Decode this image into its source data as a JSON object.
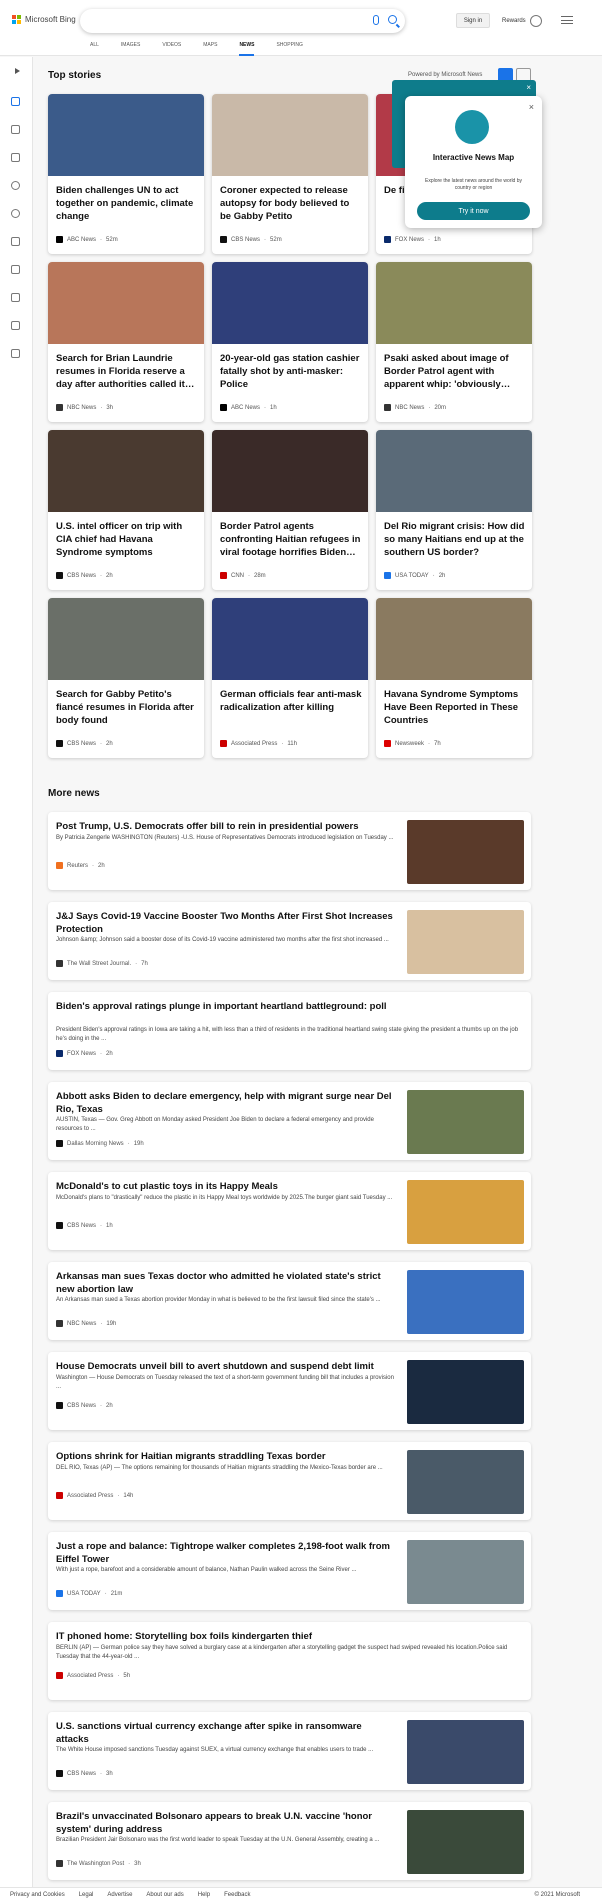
{
  "brand": {
    "name": "Microsoft Bing"
  },
  "header": {
    "sign_in": "Sign in",
    "rewards": "Rewards"
  },
  "nav_tabs": [
    "ALL",
    "IMAGES",
    "VIDEOS",
    "MAPS",
    "NEWS",
    "SHOPPING"
  ],
  "active_tab": "NEWS",
  "top_stories": {
    "heading": "Top stories",
    "powered_by": "Powered by Microsoft News",
    "cards": [
      {
        "title": "Biden challenges UN to act together on pandemic, climate change",
        "source": "ABC News",
        "age": "52m",
        "img": "#3b5b8a",
        "src_color": "#000"
      },
      {
        "title": "Coroner expected to release autopsy for body believed to be Gabby Petito",
        "source": "CBS News",
        "age": "52m",
        "img": "#c9b9a8",
        "src_color": "#111"
      },
      {
        "title": "De fi re",
        "source": "FOX News",
        "age": "1h",
        "img": "#b23a48",
        "src_color": "#0a2a6b"
      },
      {
        "title": "Search for Brian Laundrie resumes in Florida reserve a day after authorities called it…",
        "source": "NBC News",
        "age": "3h",
        "img": "#b8765a",
        "src_color": "#333"
      },
      {
        "title": "20-year-old gas station cashier fatally shot by anti-masker: Police",
        "source": "ABC News",
        "age": "1h",
        "img": "#2f3f7a",
        "src_color": "#000"
      },
      {
        "title": "Psaki asked about image of Border Patrol agent with apparent whip: 'obviously…",
        "source": "NBC News",
        "age": "20m",
        "img": "#8a8a5a",
        "src_color": "#333"
      },
      {
        "title": "U.S. intel officer on trip with CIA chief had Havana Syndrome symptoms",
        "source": "CBS News",
        "age": "2h",
        "img": "#4a3a30",
        "src_color": "#111"
      },
      {
        "title": "Border Patrol agents confronting Haitian refugees in viral footage horrifies Biden…",
        "source": "CNN",
        "age": "28m",
        "img": "#3a2a28",
        "src_color": "#c00"
      },
      {
        "title": "Del Rio migrant crisis: How did so many Haitians end up at the southern US border?",
        "source": "USA TODAY",
        "age": "2h",
        "img": "#5a6a78",
        "src_color": "#1a73e8"
      },
      {
        "title": "Search for Gabby Petito's fiancé resumes in Florida after body found",
        "source": "CBS News",
        "age": "2h",
        "img": "#6a6f68",
        "src_color": "#111"
      },
      {
        "title": "German officials fear anti-mask radicalization after killing",
        "source": "Associated Press",
        "age": "11h",
        "img": "#2f3f7a",
        "src_color": "#c00"
      },
      {
        "title": "Havana Syndrome Symptoms Have Been Reported in These Countries",
        "source": "Newsweek",
        "age": "7h",
        "img": "#8a7a60",
        "src_color": "#d00"
      }
    ]
  },
  "popup": {
    "title": "Interactive News Map",
    "desc": "Explore the latest news around the world by country or region",
    "button": "Try it now",
    "close": "×"
  },
  "more_news": {
    "heading": "More news",
    "items": [
      {
        "title": "Post Trump, U.S. Democrats offer bill to rein in presidential powers",
        "desc": "By Patricia Zengerle WASHINGTON (Reuters) -U.S. House of Representatives Democrats introduced legislation on Tuesday ...",
        "source": "Reuters",
        "age": "2h",
        "img": "#5a3a2a",
        "src_color": "#f07020"
      },
      {
        "title": "J&J Says Covid-19 Vaccine Booster Two Months After First Shot Increases Protection",
        "desc": "Johnson &amp; Johnson said a booster dose of its Covid-19 vaccine administered two months after the first shot increased ...",
        "source": "The Wall Street Journal.",
        "age": "7h",
        "img": "#d8c0a0",
        "src_color": "#333"
      },
      {
        "title": "Biden's approval ratings plunge in important heartland battleground: poll",
        "desc": "President Biden's approval ratings in Iowa are taking a hit, with less than a third of residents in the traditional heartland swing state giving the president a thumbs up on the job he's doing in the ...",
        "source": "FOX News",
        "age": "2h",
        "img": "",
        "src_color": "#0a2a6b"
      },
      {
        "title": "Abbott asks Biden to declare emergency, help with migrant surge near Del Rio, Texas",
        "desc": "AUSTIN, Texas — Gov. Greg Abbott on Monday asked President Joe Biden to declare a federal emergency and provide resources to ...",
        "source": "Dallas Morning News",
        "age": "19h",
        "img": "#6a7a50",
        "src_color": "#111"
      },
      {
        "title": "McDonald's to cut plastic toys in its Happy Meals",
        "desc": "McDonald's plans to \"drastically\" reduce the plastic in its Happy Meal toys worldwide by 2025.The burger giant said Tuesday ...",
        "source": "CBS News",
        "age": "1h",
        "img": "#d8a040",
        "src_color": "#111"
      },
      {
        "title": "Arkansas man sues Texas doctor who admitted he violated state's strict new abortion law",
        "desc": "An Arkansas man sued a Texas abortion provider Monday in what is believed to be the first lawsuit filed since the state's ...",
        "source": "NBC News",
        "age": "19h",
        "img": "#3a70c0",
        "src_color": "#333"
      },
      {
        "title": "House Democrats unveil bill to avert shutdown and suspend debt limit",
        "desc": "Washington — House Democrats on Tuesday released the text of a short-term government funding bill that includes a provision ...",
        "source": "CBS News",
        "age": "2h",
        "img": "#1a2a40",
        "src_color": "#111"
      },
      {
        "title": "Options shrink for Haitian migrants straddling Texas border",
        "desc": "DEL RIO, Texas (AP) — The options remaining for thousands of Haitian migrants straddling the Mexico-Texas border are ...",
        "source": "Associated Press",
        "age": "14h",
        "img": "#4a5a68",
        "src_color": "#c00"
      },
      {
        "title": "Just a rope and balance: Tightrope walker completes 2,198-foot walk from Eiffel Tower",
        "desc": "With just a rope, barefoot and a considerable amount of balance, Nathan Paulin walked across the Seine River ...",
        "source": "USA TODAY",
        "age": "21m",
        "img": "#7a8a90",
        "src_color": "#1a73e8"
      },
      {
        "title": "IT phoned home: Storytelling box foils kindergarten thief",
        "desc": "BERLIN (AP) — German police say they have solved a burglary case at a kindergarten after a storytelling gadget the suspect had swiped revealed his location.Police said Tuesday that the 44-year-old ...",
        "source": "Associated Press",
        "age": "5h",
        "img": "",
        "src_color": "#c00"
      },
      {
        "title": "U.S. sanctions virtual currency exchange after spike in ransomware attacks",
        "desc": "The White House imposed sanctions Tuesday against SUEX, a virtual currency exchange that enables users to trade ...",
        "source": "CBS News",
        "age": "3h",
        "img": "#3a4a6a",
        "src_color": "#111"
      },
      {
        "title": "Brazil's unvaccinated Bolsonaro appears to break U.N. vaccine 'honor system' during address",
        "desc": "Brazilian President Jair Bolsonaro was the first world leader to speak Tuesday at the U.N. General Assembly, creating a ...",
        "source": "The Washington Post",
        "age": "3h",
        "img": "#3a4a3a",
        "src_color": "#333"
      }
    ]
  },
  "footer": {
    "links": [
      "Privacy and Cookies",
      "Legal",
      "Advertise",
      "About our ads",
      "Help",
      "Feedback"
    ],
    "copyright": "© 2021 Microsoft"
  }
}
